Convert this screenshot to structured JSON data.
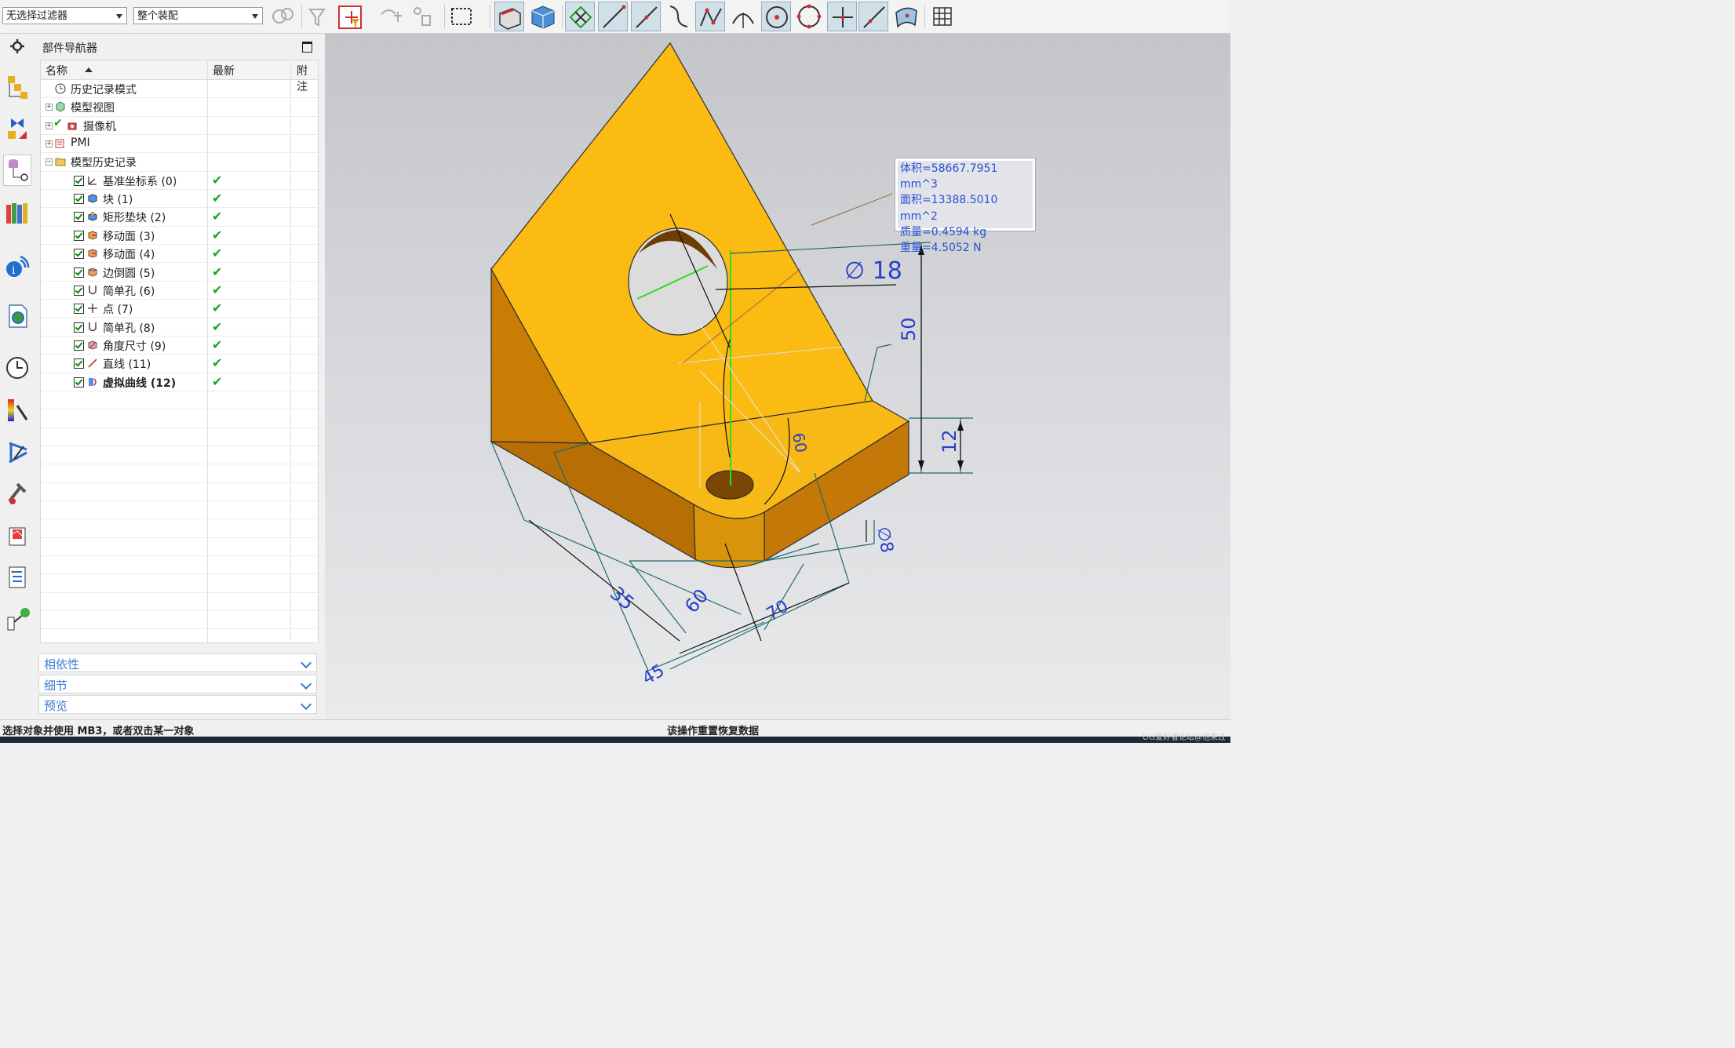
{
  "toolbar": {
    "filter_combo": "无选择过滤器",
    "scope_combo": "整个装配"
  },
  "navigator": {
    "title": "部件导航器",
    "columns": [
      "名称",
      "最新",
      "附注"
    ],
    "rows": [
      {
        "label": "历史记录模式"
      },
      {
        "label": "模型视图"
      },
      {
        "label": "摄像机"
      },
      {
        "label": "PMI"
      },
      {
        "label": "模型历史记录"
      },
      {
        "label": "基准坐标系 (0)",
        "latest": "✔"
      },
      {
        "label": "块 (1)",
        "latest": "✔"
      },
      {
        "label": "矩形垫块 (2)",
        "latest": "✔"
      },
      {
        "label": "移动面 (3)",
        "latest": "✔"
      },
      {
        "label": "移动面 (4)",
        "latest": "✔"
      },
      {
        "label": "边倒圆 (5)",
        "latest": "✔"
      },
      {
        "label": "简单孔 (6)",
        "latest": "✔"
      },
      {
        "label": "点 (7)",
        "latest": "✔"
      },
      {
        "label": "简单孔 (8)",
        "latest": "✔"
      },
      {
        "label": "角度尺寸 (9)",
        "latest": "✔"
      },
      {
        "label": "直线 (11)",
        "latest": "✔"
      },
      {
        "label": "虚拟曲线 (12)",
        "latest": "✔"
      }
    ],
    "panels": [
      "相依性",
      "细节",
      "预览"
    ]
  },
  "measurement": {
    "volume": "体积=58667.7951 mm^3",
    "area": "面积=13388.5010 mm^2",
    "mass": "质量=0.4594 kg",
    "weight": "重量=4.5052 N"
  },
  "dimensions": {
    "d18": "∅ 18",
    "d50": "50",
    "d12": "12",
    "a60": "60",
    "d35": "35",
    "d60b": "60",
    "d70": "70",
    "d45": "45",
    "d8": "∅8"
  },
  "status": {
    "left": "选择对象并使用 MB3，或者双击某一对象",
    "center": "该操作重置恢复数据"
  },
  "watermark": "UG爱好者论坛@他来过",
  "colors": {
    "part": "#f7b315",
    "dimension": "#2040c0",
    "checkmark": "#19a51b"
  }
}
